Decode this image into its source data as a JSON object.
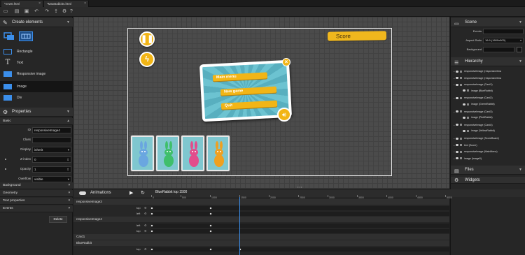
{
  "tabs": [
    {
      "label": "*new0.html"
    },
    {
      "label": "*MaxBabbits.html"
    }
  ],
  "toolbar": {
    "icons": [
      "new-file-icon",
      "open-folder-icon",
      "save-icon",
      "undo-icon",
      "redo-icon",
      "export-icon",
      "settings-icon",
      "help-icon"
    ]
  },
  "create_elements": {
    "title": "Create elements",
    "items": [
      {
        "label": "Rectangle",
        "icon": "rectangle-icon"
      },
      {
        "label": "Text",
        "icon": "text-icon"
      },
      {
        "label": "Responsive image",
        "icon": "responsive-image-icon"
      },
      {
        "label": "Image",
        "icon": "image-icon"
      },
      {
        "label": "Div",
        "icon": "div-icon"
      }
    ]
  },
  "properties": {
    "title": "Properties",
    "basic_label": "Basic",
    "fields": [
      {
        "label": "ID",
        "value": "responsiveImage4"
      },
      {
        "label": "Class",
        "value": ""
      },
      {
        "label": "Display",
        "value": "inherit"
      },
      {
        "label": "Z-index",
        "value": "0"
      },
      {
        "label": "Opacity",
        "value": "1"
      },
      {
        "label": "Overflow",
        "value": "visible"
      }
    ],
    "sections": [
      "Background",
      "Geometry",
      "Text properties",
      "Events"
    ],
    "delete_label": "Delete"
  },
  "stage": {
    "score_label": "Score",
    "menu_buttons": [
      "Main menu",
      "New game",
      "Quit"
    ],
    "cards": [
      {
        "name": "BlueRabbit",
        "color": "#6aa6e0"
      },
      {
        "name": "GreenRabbit",
        "color": "#3fbf6b"
      },
      {
        "name": "PinkRabbit",
        "color": "#e24d8c"
      },
      {
        "name": "YellowRabbit",
        "color": "#f0a020"
      }
    ]
  },
  "scene": {
    "title": "Scene",
    "fields": [
      {
        "label": "Events",
        "value": ""
      },
      {
        "label": "Aspect Ratio",
        "value": "16:9 (1600x900)"
      },
      {
        "label": "Background",
        "value": ""
      }
    ]
  },
  "hierarchy": {
    "title": "Hierarchy",
    "rows": [
      {
        "text": "responsiveImage (responsiveIma",
        "indent": 0
      },
      {
        "text": "responsiveImage (responsiveIma",
        "indent": 0
      },
      {
        "text": "responsiveImage (Card1)",
        "indent": 0
      },
      {
        "text": "image (BlueRabbit)",
        "indent": 1
      },
      {
        "text": "responsiveImage (Card2)",
        "indent": 0
      },
      {
        "text": "image (GreenRabbit)",
        "indent": 1
      },
      {
        "text": "responsiveImage (Card3)",
        "indent": 0
      },
      {
        "text": "image (PinkRabbit)",
        "indent": 1
      },
      {
        "text": "responsiveImage (Card4)",
        "indent": 0
      },
      {
        "text": "image (YellowRabbit)",
        "indent": 1
      },
      {
        "text": "responsiveImage (ScoreBoard)",
        "indent": 0
      },
      {
        "text": "text (Score)",
        "indent": 0
      },
      {
        "text": "responsiveImage (MainMenu)",
        "indent": 0
      },
      {
        "text": "image (image0)",
        "indent": 0
      }
    ]
  },
  "files": {
    "title": "Files"
  },
  "widgets": {
    "title": "Widgets"
  },
  "animations": {
    "title": "Animations",
    "current": "BlueRabbit top 1500",
    "ruler_labels": [
      "0",
      "500",
      "1000",
      "1500",
      "2000",
      "2500",
      "3000",
      "3500",
      "4000",
      "4500",
      "5000"
    ],
    "groups": [
      {
        "name": "responsiveImage3",
        "props": [
          {
            "name": "top",
            "keys": [
              0,
              1000
            ]
          },
          {
            "name": "left",
            "keys": [
              0,
              1000
            ]
          }
        ]
      },
      {
        "name": "responsiveImage4",
        "props": [
          {
            "name": "left",
            "keys": [
              0,
              1000
            ]
          },
          {
            "name": "top",
            "keys": [
              0,
              1000
            ]
          }
        ]
      },
      {
        "name": "Card1",
        "props": []
      },
      {
        "name": "BlueRabbit",
        "props": [
          {
            "name": "top",
            "keys": [
              0,
              1000,
              1500
            ]
          }
        ]
      }
    ],
    "playhead": 1500
  }
}
